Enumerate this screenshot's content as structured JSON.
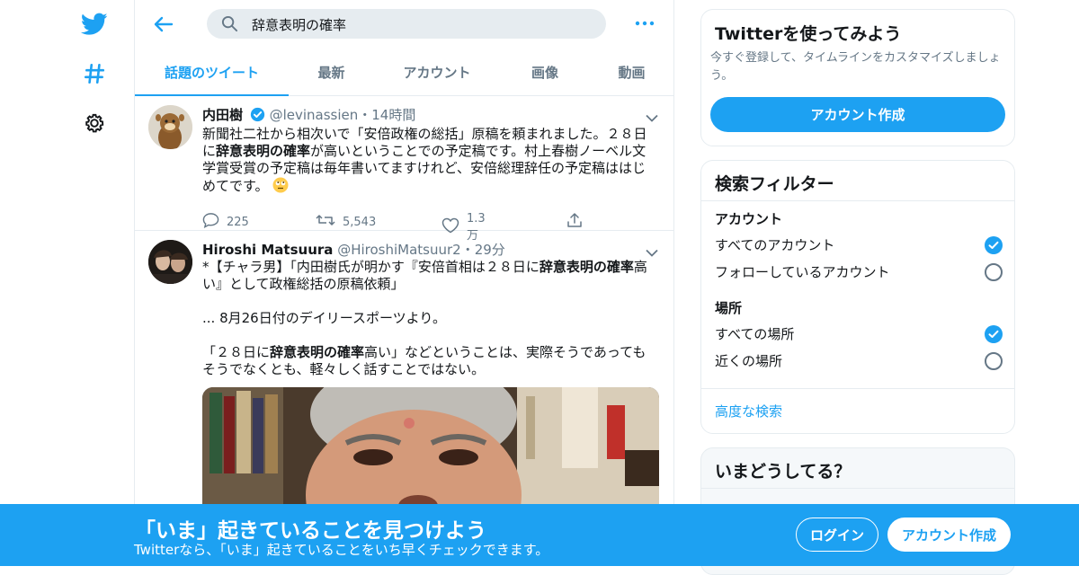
{
  "nav": {
    "icons": [
      "twitter-bird-icon",
      "hashtag-icon",
      "settings-gear-icon"
    ]
  },
  "search": {
    "query": "辞意表明の確率"
  },
  "tabs": [
    "話題のツイート",
    "最新",
    "アカウント",
    "画像",
    "動画"
  ],
  "tweets": [
    {
      "name": "内田樹",
      "verified": true,
      "handle": "@levinassien",
      "sep": "・",
      "time": "14時間",
      "text_parts": [
        "新聞社二社から相次いで「安倍政権の総括」原稿を頼まれました。２８日に",
        "辞意表明の確率",
        "が高いということでの予定稿です。村上春樹ノーベル文学賞受賞の予定稿は毎年書いてますけれど、安倍総理辞任の予定稿ははじめてです。"
      ],
      "emoji": "rolling-eyes-emoji",
      "replies": "225",
      "retweets": "5,543",
      "likes": "1.3万"
    },
    {
      "name": "Hiroshi Matsuura",
      "verified": false,
      "handle": "@HiroshiMatsuur2",
      "sep": "・",
      "time": "29分",
      "line1_parts": [
        "*【チャラ男】「内田樹氏が明かす『安倍首相は２８日に",
        "辞意表明の確率",
        "高い』として政権総括の原稿依頼」"
      ],
      "line2": "... 8月26日付のデイリースポーツより。",
      "line3_parts": [
        "「２８日に",
        "辞意表明の確率",
        "高い」などということは、実際そうであってもそうでなくとも、軽々しく話すことではない。"
      ]
    }
  ],
  "sidebar": {
    "signup_card": {
      "title": "Twitterを使ってみよう",
      "desc": "今すぐ登録して、タイムラインをカスタマイズしましょう。",
      "button": "アカウント作成"
    },
    "filter_card": {
      "title": "検索フィルター",
      "account_label": "アカウント",
      "account_options": [
        {
          "label": "すべてのアカウント",
          "checked": true
        },
        {
          "label": "フォローしているアカウント",
          "checked": false
        }
      ],
      "place_label": "場所",
      "place_options": [
        {
          "label": "すべての場所",
          "checked": true
        },
        {
          "label": "近くの場所",
          "checked": false
        }
      ],
      "advanced_link": "高度な検索"
    },
    "trends_card": {
      "title": "いまどうしてる？"
    }
  },
  "banner": {
    "title": "「いま」起きていることを見つけよう",
    "subtitle": "Twitterなら、「いま」起きていることをいち早くチェックできます。",
    "login": "ログイン",
    "signup": "アカウント作成"
  },
  "colors": {
    "accent": "#1da1f2",
    "muted": "#657786",
    "border": "#e6ecf0"
  }
}
